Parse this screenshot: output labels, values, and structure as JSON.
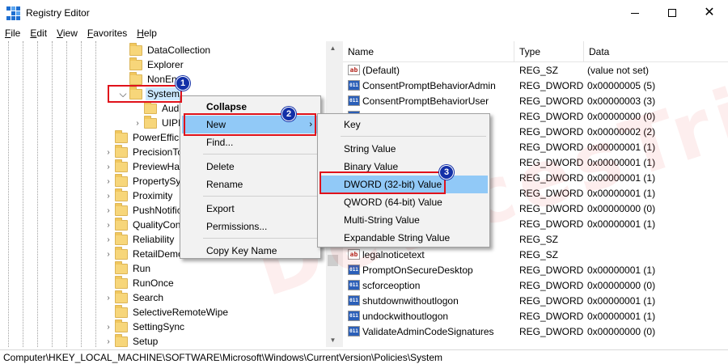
{
  "window": {
    "title": "Registry Editor"
  },
  "menubar": [
    "File",
    "Edit",
    "View",
    "Favorites",
    "Help"
  ],
  "tree": {
    "rows": [
      {
        "label": "DataCollection",
        "indent": 2,
        "chevron": ""
      },
      {
        "label": "Explorer",
        "indent": 2,
        "chevron": ""
      },
      {
        "label": "NonEn",
        "indent": 2,
        "chevron": ""
      },
      {
        "label": "System",
        "indent": 2,
        "chevron": "down",
        "selected": true
      },
      {
        "label": "Aud",
        "indent": 3,
        "chevron": ""
      },
      {
        "label": "UIPI",
        "indent": 3,
        "chevron": "right"
      },
      {
        "label": "PowerEffici",
        "indent": 1,
        "chevron": ""
      },
      {
        "label": "PrecisionTo",
        "indent": 1,
        "chevron": "right"
      },
      {
        "label": "PreviewHar",
        "indent": 1,
        "chevron": "right"
      },
      {
        "label": "PropertySys",
        "indent": 1,
        "chevron": "right"
      },
      {
        "label": "Proximity",
        "indent": 1,
        "chevron": "right"
      },
      {
        "label": "PushNotific",
        "indent": 1,
        "chevron": "right"
      },
      {
        "label": "QualityCon",
        "indent": 1,
        "chevron": "right"
      },
      {
        "label": "Reliability",
        "indent": 1,
        "chevron": "right"
      },
      {
        "label": "RetailDemo",
        "indent": 1,
        "chevron": "right"
      },
      {
        "label": "Run",
        "indent": 1,
        "chevron": ""
      },
      {
        "label": "RunOnce",
        "indent": 1,
        "chevron": ""
      },
      {
        "label": "Search",
        "indent": 1,
        "chevron": "right"
      },
      {
        "label": "SelectiveRemoteWipe",
        "indent": 1,
        "chevron": ""
      },
      {
        "label": "SettingSync",
        "indent": 1,
        "chevron": "right"
      },
      {
        "label": "Setup",
        "indent": 1,
        "chevron": "right"
      }
    ]
  },
  "list": {
    "headers": {
      "name": "Name",
      "type": "Type",
      "data": "Data"
    },
    "rows": [
      {
        "icon": "sz",
        "name": "(Default)",
        "type": "REG_SZ",
        "data": "(value not set)"
      },
      {
        "icon": "dw",
        "name": "ConsentPromptBehaviorAdmin",
        "type": "REG_DWORD",
        "data": "0x00000005 (5)"
      },
      {
        "icon": "dw",
        "name": "ConsentPromptBehaviorUser",
        "type": "REG_DWORD",
        "data": "0x00000003 (3)"
      },
      {
        "icon": "dw",
        "name": "",
        "type": "REG_DWORD",
        "data": "0x00000000 (0)"
      },
      {
        "icon": "dw",
        "name": "",
        "type": "REG_DWORD",
        "data": "0x00000002 (2)"
      },
      {
        "icon": "dw",
        "name": "",
        "type": "REG_DWORD",
        "data": "0x00000001 (1)"
      },
      {
        "icon": "dw",
        "name": "",
        "type": "REG_DWORD",
        "data": "0x00000001 (1)"
      },
      {
        "icon": "dw",
        "name": "",
        "type": "REG_DWORD",
        "data": "0x00000001 (1)"
      },
      {
        "icon": "dw",
        "name": "",
        "type": "REG_DWORD",
        "data": "0x00000001 (1)"
      },
      {
        "icon": "dw",
        "name": "",
        "type": "REG_DWORD",
        "data": "0x00000000 (0)"
      },
      {
        "icon": "dw",
        "name": "",
        "type": "REG_DWORD",
        "data": "0x00000001 (1)"
      },
      {
        "icon": "sz",
        "name": "",
        "type": "REG_SZ",
        "data": ""
      },
      {
        "icon": "sz",
        "name": "legalnoticetext",
        "type": "REG_SZ",
        "data": ""
      },
      {
        "icon": "dw",
        "name": "PromptOnSecureDesktop",
        "type": "REG_DWORD",
        "data": "0x00000001 (1)"
      },
      {
        "icon": "dw",
        "name": "scforceoption",
        "type": "REG_DWORD",
        "data": "0x00000000 (0)"
      },
      {
        "icon": "dw",
        "name": "shutdownwithoutlogon",
        "type": "REG_DWORD",
        "data": "0x00000001 (1)"
      },
      {
        "icon": "dw",
        "name": "undockwithoutlogon",
        "type": "REG_DWORD",
        "data": "0x00000001 (1)"
      },
      {
        "icon": "dw",
        "name": "ValidateAdminCodeSignatures",
        "type": "REG_DWORD",
        "data": "0x00000000 (0)"
      }
    ]
  },
  "context_menu": {
    "items": [
      {
        "label": "Collapse",
        "bold": true
      },
      {
        "label": "New",
        "submenu": true,
        "highlighted": true
      },
      {
        "label": "Find..."
      },
      {
        "sep": true
      },
      {
        "label": "Delete"
      },
      {
        "label": "Rename"
      },
      {
        "sep": true
      },
      {
        "label": "Export"
      },
      {
        "label": "Permissions..."
      },
      {
        "sep": true
      },
      {
        "label": "Copy Key Name"
      }
    ]
  },
  "submenu": {
    "items": [
      {
        "label": "Key"
      },
      {
        "sep": true
      },
      {
        "label": "String Value"
      },
      {
        "label": "Binary Value"
      },
      {
        "label": "DWORD (32-bit) Value",
        "highlighted": true
      },
      {
        "label": "QWORD (64-bit) Value"
      },
      {
        "label": "Multi-String Value"
      },
      {
        "label": "Expandable String Value"
      }
    ]
  },
  "callouts": {
    "b1": "1",
    "b2": "2",
    "b3": "3"
  },
  "status": {
    "path": "Computer\\HKEY_LOCAL_MACHINE\\SOFTWARE\\Microsoft\\Windows\\CurrentVersion\\Policies\\System"
  },
  "watermark": {
    "text": "DevicesTricks"
  },
  "colors": {
    "callout_red": "#e0121b",
    "badge_blue": "#1330a8",
    "highlight": "#91c9f7",
    "selection": "#cce8ff"
  }
}
